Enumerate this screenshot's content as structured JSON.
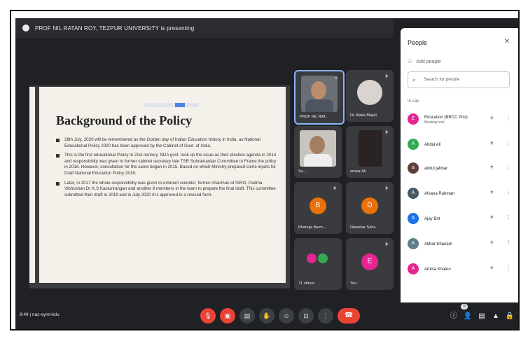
{
  "presenting": {
    "text": "PROF NIL RATAN ROY, TEZPUR UNIVERSITY is presenting"
  },
  "slide": {
    "title": "Background of the Policy",
    "bullets": [
      "28th July, 2020 will be remembered as the Golden day of Indian Education history in India, as National Educational Policy 2020 has been approved by the Cabinet of Govt. of India.",
      "This is the first educational Policy in 21st century. NDA govt. took up the issue as their election agenda in 2014 and responsibility was given to former cabinet secretary late TSR Subramanian Committee to Frame the policy in 2016. However, consultation for the same began in 2015. Based on which Ministry prepared some inputs for Draft National Education Policy 2016.",
      "Later, in 2017 the whole responsibility was given to eminent scientist, former chairman of ISRO, Padma Vibhushan Dr K.S Kasturirangan and another 8 members in the team to prepare the final draft. This committee submitted their draft in 2019 and in July 2020 it is approved in a revised form."
    ]
  },
  "tiles": [
    {
      "name": "PROF NIL RAT...",
      "initial": "",
      "color": "#ffffff"
    },
    {
      "name": "Dr. Alaka Majuli",
      "initial": "",
      "color": "#ffffff"
    },
    {
      "name": "Su...",
      "initial": "",
      "color": "#ffffff"
    },
    {
      "name": "anwar Ali",
      "initial": "",
      "color": "#ffffff"
    },
    {
      "name": "Bhanuja Barm...",
      "initial": "B",
      "color": "#e8710a"
    },
    {
      "name": "Dipankar Saha",
      "initial": "D",
      "color": "#e8710a"
    },
    {
      "name": "71 others",
      "initial": "",
      "color": "#ffffff"
    },
    {
      "name": "You",
      "initial": "E",
      "color": "#e52592"
    }
  ],
  "meeting_code": "8:49  |  naz-xyml-kdu",
  "people": {
    "title": "People",
    "add": "Add people",
    "search_placeholder": "Search for people",
    "section": "In call",
    "list": [
      {
        "name": "Education (BRCC Pnu)",
        "sub": "Meeting host",
        "initial": "E",
        "color": "#e52592"
      },
      {
        "name": "Abdul Ali",
        "sub": "",
        "initial": "A",
        "color": "#34a853"
      },
      {
        "name": "abdul jabbar",
        "sub": "",
        "initial": "a",
        "color": "#5d4037"
      },
      {
        "name": "Afsana Rahman",
        "sub": "",
        "initial": "A",
        "color": "#455a64"
      },
      {
        "name": "Ajay Brit",
        "sub": "",
        "initial": "A",
        "color": "#1a73e8"
      },
      {
        "name": "Akbar Khanam",
        "sub": "",
        "initial": "A",
        "color": "#607d8b"
      },
      {
        "name": "Amina Khatun",
        "sub": "",
        "initial": "A",
        "color": "#e52592"
      }
    ]
  },
  "participant_count": "75"
}
